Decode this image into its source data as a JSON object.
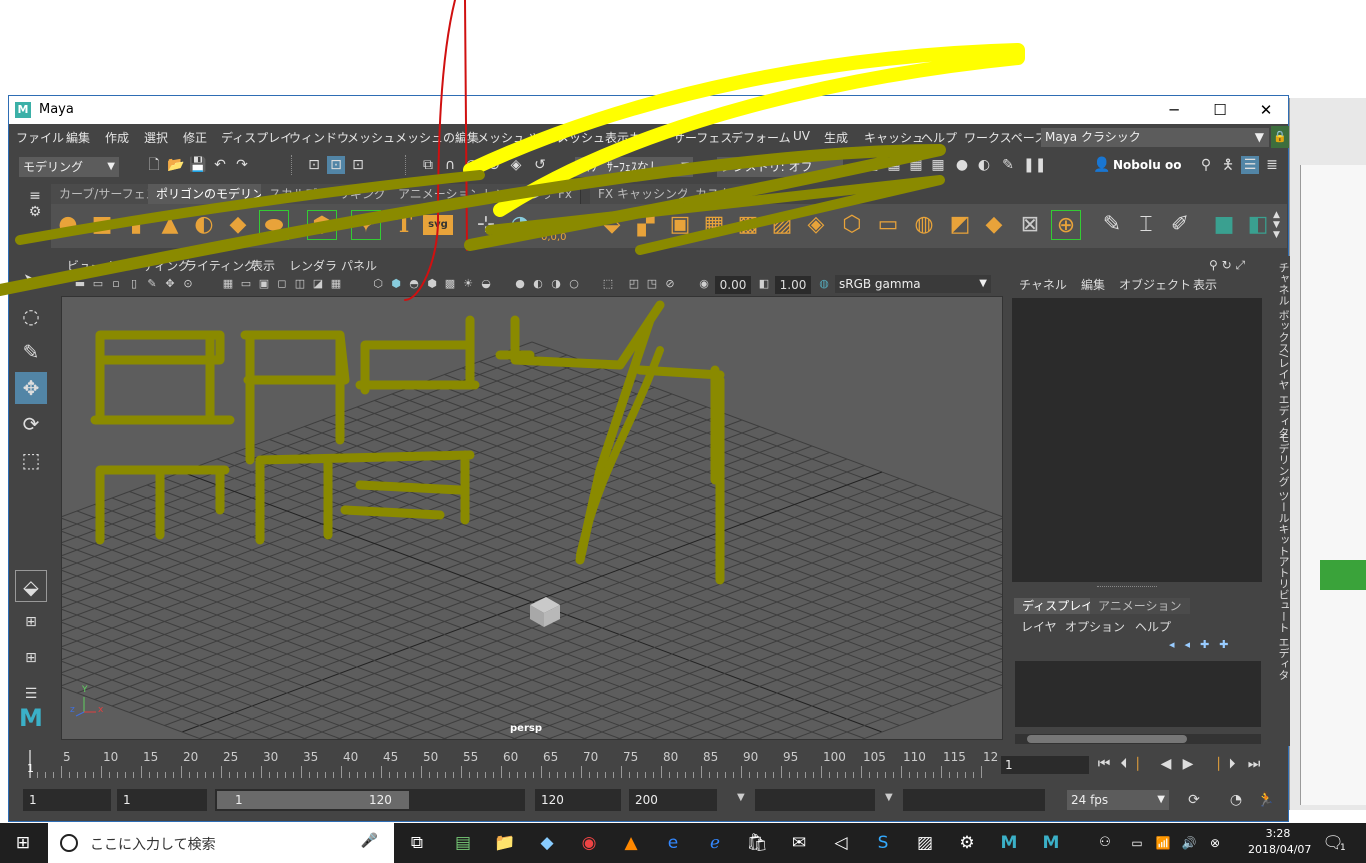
{
  "window": {
    "title": "Maya",
    "logo": "M",
    "minimize": "─",
    "maximize": "☐",
    "close": "✕"
  },
  "menubar": {
    "items": [
      "ファイル",
      "編集",
      "作成",
      "選択",
      "修正",
      "ディスプレイ",
      "ウィンドウ",
      "メッシュ",
      "メッシュの編集",
      "メッシュ ツール",
      "メッシュ表示",
      "カーブ",
      "サーフェス",
      "デフォーム",
      "UV",
      "生成",
      "キャッシュ",
      "ヘルプ"
    ],
    "workspace_label": "ワークスペース:",
    "workspace_value": "Maya クラシック"
  },
  "statusline": {
    "menuset": "モデリング",
    "live_surface": "ﾗｲﾌﾞ ｻｰﾌｪｽなし",
    "symmetry": "シンメトリ: オフ",
    "user": "Nobolu oo"
  },
  "shelf": {
    "tabs": [
      "カーブ/サーフェス",
      "ポリゴンのモデリング",
      "スカルプト",
      "リギング",
      "アニメーション",
      "レンダリング",
      "Fx",
      "FX キャッシング",
      "カスタム"
    ],
    "active_tab": "ポリゴンのモデリング",
    "text_icon": "T",
    "svg_icon": "svg",
    "coord_readout": "0,0,0"
  },
  "viewport": {
    "menu": [
      "ビュー",
      "シェーディング",
      "ライティング",
      "表示",
      "レンダラ",
      "パネル"
    ],
    "exposure": "0.00",
    "gamma": "1.00",
    "colorspace": "sRGB gamma",
    "camera_label": "persp",
    "axis_x": "x",
    "axis_y": "Y",
    "axis_z": "z"
  },
  "channelbox": {
    "menu": [
      "チャネル",
      "編集",
      "オブジェクト",
      "表示"
    ],
    "layer_tabs": [
      "ディスプレイ",
      "アニメーション"
    ],
    "layer_menu": [
      "レイヤ",
      "オプション",
      "ヘルプ"
    ]
  },
  "side_tabs": [
    "チャネル ボックス/レイヤ エディタ",
    "モデリング ツールキット",
    "アトリビュート エディタ"
  ],
  "timeslider": {
    "ticks": [
      "5",
      "10",
      "15",
      "20",
      "25",
      "30",
      "35",
      "40",
      "45",
      "50",
      "55",
      "60",
      "65",
      "70",
      "75",
      "80",
      "85",
      "90",
      "95",
      "100",
      "105",
      "110",
      "115",
      "12"
    ],
    "start_marker": "1",
    "current_frame": "1"
  },
  "range": {
    "start": "1",
    "playback_start": "1",
    "slider_start": "1",
    "slider_end": "120",
    "playback_end": "120",
    "end": "200",
    "fps": "24 fps"
  },
  "taskbar": {
    "search_placeholder": "ここに入力して検索",
    "time": "3:28",
    "date": "2018/04/07",
    "notification_count": "1"
  },
  "colors": {
    "scribble_yellow": "#ffff00",
    "scribble_olive": "#8a8a00",
    "scribble_red": "#d01010",
    "accent_orange": "#e8a33a",
    "selection_blue": "#5285a6"
  }
}
